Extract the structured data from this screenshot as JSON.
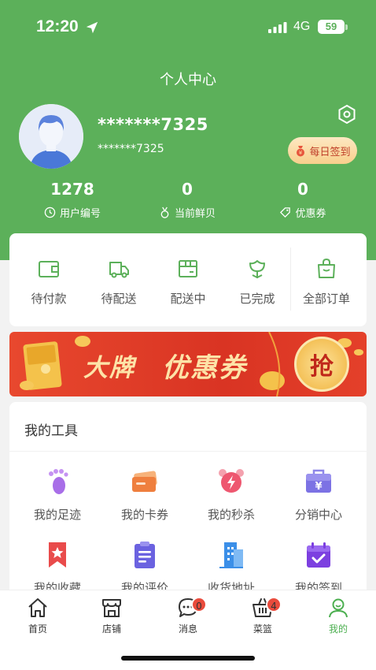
{
  "status_bar": {
    "time": "12:20",
    "network": "4G",
    "battery": "59"
  },
  "header": {
    "title": "个人中心"
  },
  "profile": {
    "name": "*******7325",
    "sub": "*******7325",
    "signin_label": "每日签到"
  },
  "stats": [
    {
      "value": "1278",
      "label": "用户编号"
    },
    {
      "value": "0",
      "label": "当前鲜贝"
    },
    {
      "value": "0",
      "label": "优惠券"
    }
  ],
  "orders": [
    {
      "label": "待付款",
      "icon": "wallet-icon"
    },
    {
      "label": "待配送",
      "icon": "truck-icon"
    },
    {
      "label": "配送中",
      "icon": "box-icon"
    },
    {
      "label": "已完成",
      "icon": "flower-icon"
    },
    {
      "label": "全部订单",
      "icon": "bag-icon"
    }
  ],
  "banner": {
    "text1": "大牌",
    "text2": "优惠券",
    "grab": "抢"
  },
  "tools": {
    "title": "我的工具",
    "items": [
      {
        "label": "我的足迹",
        "icon": "footprint-icon"
      },
      {
        "label": "我的卡券",
        "icon": "card-icon"
      },
      {
        "label": "我的秒杀",
        "icon": "alarm-icon"
      },
      {
        "label": "分销中心",
        "icon": "briefcase-icon"
      },
      {
        "label": "我的收藏",
        "icon": "bookmark-star-icon"
      },
      {
        "label": "我的评价",
        "icon": "clipboard-icon"
      },
      {
        "label": "收货地址",
        "icon": "building-icon"
      },
      {
        "label": "我的签到",
        "icon": "calendar-check-icon"
      }
    ]
  },
  "tabbar": [
    {
      "label": "首页",
      "icon": "home-icon"
    },
    {
      "label": "店铺",
      "icon": "store-icon"
    },
    {
      "label": "消息",
      "icon": "message-icon",
      "badge": "0"
    },
    {
      "label": "菜篮",
      "icon": "basket-icon",
      "badge": "4"
    },
    {
      "label": "我的",
      "icon": "user-icon"
    }
  ],
  "colors": {
    "brand_green": "#5cb05a",
    "badge_red": "#e94b3c",
    "banner_red": "#d93423"
  }
}
